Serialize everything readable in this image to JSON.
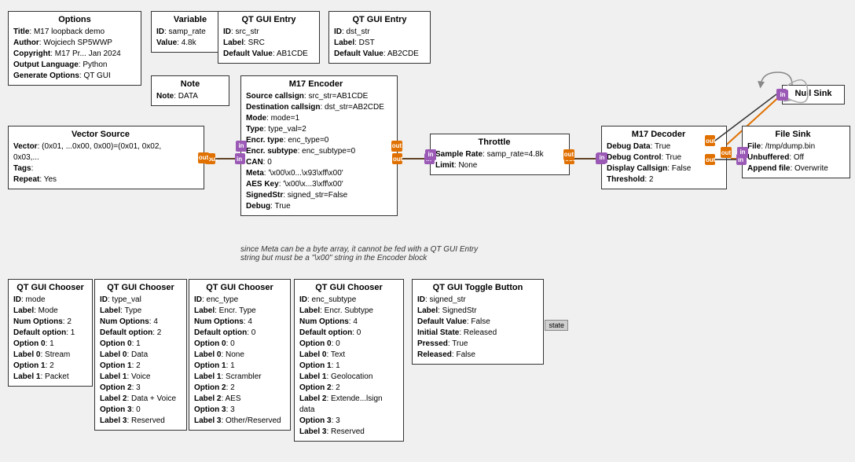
{
  "blocks": {
    "options": {
      "title": "Options",
      "rows": [
        {
          "label": "Title",
          "value": "M17 loopback demo"
        },
        {
          "label": "Author",
          "value": "Wojciech SP5WWP"
        },
        {
          "label": "Copyright",
          "value": "M17 Pr... Jan 2024"
        },
        {
          "label": "Output Language",
          "value": "Python"
        },
        {
          "label": "Generate Options",
          "value": "QT GUI"
        }
      ]
    },
    "variable": {
      "title": "Variable",
      "rows": [
        {
          "label": "ID",
          "value": "samp_rate"
        },
        {
          "label": "Value",
          "value": "4.8k"
        }
      ]
    },
    "note": {
      "title": "Note",
      "rows": [
        {
          "label": "Note",
          "value": "DATA"
        }
      ]
    },
    "qt_gui_entry_src": {
      "title": "QT GUI Entry",
      "rows": [
        {
          "label": "ID",
          "value": "src_str"
        },
        {
          "label": "Label",
          "value": "SRC"
        },
        {
          "label": "Default Value",
          "value": "AB1CDE"
        }
      ]
    },
    "qt_gui_entry_dst": {
      "title": "QT GUI Entry",
      "rows": [
        {
          "label": "ID",
          "value": "dst_str"
        },
        {
          "label": "Label",
          "value": "DST"
        },
        {
          "label": "Default Value",
          "value": "AB2CDE"
        }
      ]
    },
    "vector_source": {
      "title": "Vector Source",
      "rows": [
        {
          "label": "Vector",
          "value": "(0x01, ...0x00, 0x00)=(0x01, 0x02, 0x03,..."
        },
        {
          "label": "Tags",
          "value": ""
        },
        {
          "label": "Repeat",
          "value": "Yes"
        }
      ]
    },
    "m17_encoder": {
      "title": "M17 Encoder",
      "rows": [
        {
          "label": "Source callsign",
          "value": "src_str=AB1CDE"
        },
        {
          "label": "Destination callsign",
          "value": "dst_str=AB2CDE"
        },
        {
          "label": "Mode",
          "value": "mode=1"
        },
        {
          "label": "Type",
          "value": "type_val=2"
        },
        {
          "label": "Encr. type",
          "value": "enc_type=0"
        },
        {
          "label": "Encr. subtype",
          "value": "enc_subtype=0"
        },
        {
          "label": "CAN",
          "value": "0"
        },
        {
          "label": "Meta",
          "value": "'\\x00\\x0...\\x93\\xff\\x00'"
        },
        {
          "label": "AES Key",
          "value": "'\\x00\\x...3\\xff\\x00'"
        },
        {
          "label": "SignedStr",
          "value": "signed_str=False"
        },
        {
          "label": "Debug",
          "value": "True"
        }
      ]
    },
    "throttle": {
      "title": "Throttle",
      "rows": [
        {
          "label": "Sample Rate",
          "value": "samp_rate=4.8k"
        },
        {
          "label": "Limit",
          "value": "None"
        }
      ]
    },
    "m17_decoder": {
      "title": "M17 Decoder",
      "rows": [
        {
          "label": "Debug Data",
          "value": "True"
        },
        {
          "label": "Debug Control",
          "value": "True"
        },
        {
          "label": "Display Callsign",
          "value": "False"
        },
        {
          "label": "Threshold",
          "value": "2"
        }
      ]
    },
    "null_sink": {
      "title": "Null Sink",
      "rows": []
    },
    "file_sink": {
      "title": "File Sink",
      "rows": [
        {
          "label": "File",
          "value": "/tmp/dump.bin"
        },
        {
          "label": "Unbuffered",
          "value": "Off"
        },
        {
          "label": "Append file",
          "value": "Overwrite"
        }
      ]
    },
    "qt_gui_chooser_mode": {
      "title": "QT GUI Chooser",
      "rows": [
        {
          "label": "ID",
          "value": "mode"
        },
        {
          "label": "Label",
          "value": "Mode"
        },
        {
          "label": "Num Options",
          "value": "2"
        },
        {
          "label": "Default option",
          "value": "1"
        },
        {
          "label": "Option 0",
          "value": "1"
        },
        {
          "label": "Label 0",
          "value": "Stream"
        },
        {
          "label": "Option 1",
          "value": "2"
        },
        {
          "label": "Label 1",
          "value": "Packet"
        }
      ]
    },
    "qt_gui_chooser_type": {
      "title": "QT GUI Chooser",
      "rows": [
        {
          "label": "ID",
          "value": "type_val"
        },
        {
          "label": "Label",
          "value": "Type"
        },
        {
          "label": "Num Options",
          "value": "4"
        },
        {
          "label": "Default option",
          "value": "2"
        },
        {
          "label": "Option 0",
          "value": "1"
        },
        {
          "label": "Label 0",
          "value": "Data"
        },
        {
          "label": "Option 1",
          "value": "2"
        },
        {
          "label": "Label 1",
          "value": "Voice"
        },
        {
          "label": "Option 2",
          "value": "3"
        },
        {
          "label": "Label 2",
          "value": "Data + Voice"
        },
        {
          "label": "Option 3",
          "value": "0"
        },
        {
          "label": "Label 3",
          "value": "Reserved"
        }
      ]
    },
    "qt_gui_chooser_enctype": {
      "title": "QT GUI Chooser",
      "rows": [
        {
          "label": "ID",
          "value": "enc_type"
        },
        {
          "label": "Label",
          "value": "Encr. Type"
        },
        {
          "label": "Num Options",
          "value": "4"
        },
        {
          "label": "Default option",
          "value": "0"
        },
        {
          "label": "Option 0",
          "value": "0"
        },
        {
          "label": "Label 0",
          "value": "None"
        },
        {
          "label": "Option 1",
          "value": "1"
        },
        {
          "label": "Label 1",
          "value": "Scrambler"
        },
        {
          "label": "Option 2",
          "value": "2"
        },
        {
          "label": "Label 2",
          "value": "AES"
        },
        {
          "label": "Option 3",
          "value": "3"
        },
        {
          "label": "Label 3",
          "value": "Other/Reserved"
        }
      ]
    },
    "qt_gui_chooser_encsubtype": {
      "title": "QT GUI Chooser",
      "rows": [
        {
          "label": "ID",
          "value": "enc_subtype"
        },
        {
          "label": "Label",
          "value": "Encr. Subtype"
        },
        {
          "label": "Num Options",
          "value": "4"
        },
        {
          "label": "Default option",
          "value": "0"
        },
        {
          "label": "Option 0",
          "value": "0"
        },
        {
          "label": "Label 0",
          "value": "Text"
        },
        {
          "label": "Option 1",
          "value": "1"
        },
        {
          "label": "Label 1",
          "value": "Geolocation"
        },
        {
          "label": "Option 2",
          "value": "2"
        },
        {
          "label": "Label 2",
          "value": "Extende...lsign data"
        },
        {
          "label": "Option 3",
          "value": "3"
        },
        {
          "label": "Label 3",
          "value": "Reserved"
        }
      ]
    },
    "qt_gui_toggle": {
      "title": "QT GUI Toggle Button",
      "rows": [
        {
          "label": "ID",
          "value": "signed_str"
        },
        {
          "label": "Label",
          "value": "SignedStr"
        },
        {
          "label": "Default Value",
          "value": "False"
        },
        {
          "label": "Initial State",
          "value": "Released"
        },
        {
          "label": "Pressed",
          "value": "True"
        },
        {
          "label": "Released",
          "value": "False"
        }
      ]
    }
  },
  "annotations": {
    "note_line1": "since Meta can be a byte array, it cannot be fed with a QT GUI Entry",
    "note_line2": "string but must be a \"\\x00\" string in the Encoder block"
  },
  "state_label": "state"
}
